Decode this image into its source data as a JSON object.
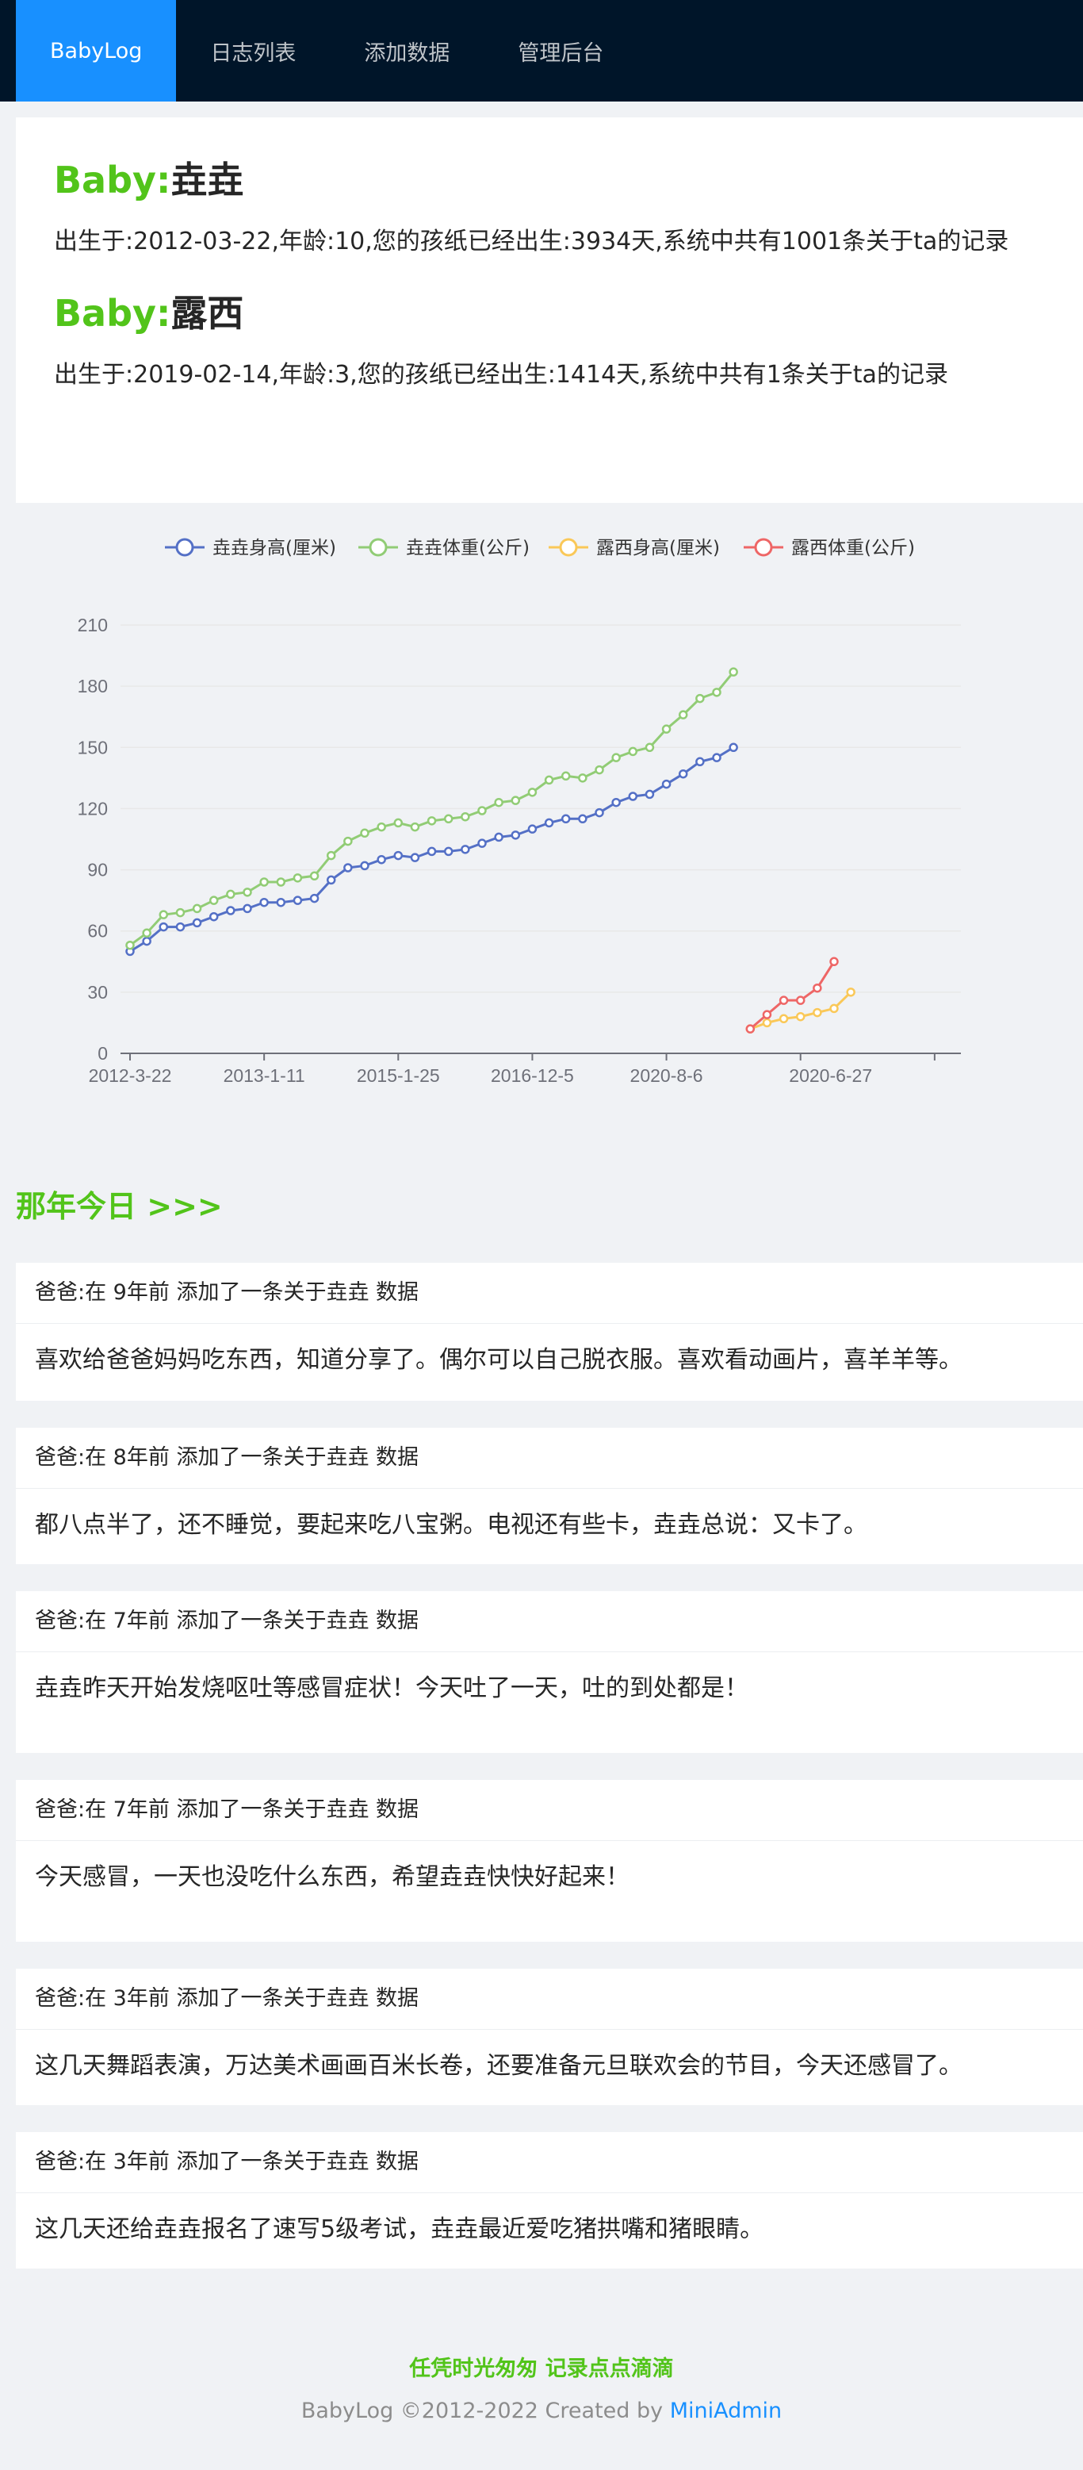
{
  "nav": {
    "items": [
      {
        "label": "BabyLog",
        "active": true
      },
      {
        "label": "日志列表",
        "active": false
      },
      {
        "label": "添加数据",
        "active": false
      },
      {
        "label": "管理后台",
        "active": false
      }
    ]
  },
  "babies": [
    {
      "prefix": "Baby:",
      "name": "垚垚",
      "desc": "出生于:2012-03-22,年龄:10,您的孩纸已经出生:3934天,系统中共有1001条关于ta的记录"
    },
    {
      "prefix": "Baby:",
      "name": "露西",
      "desc": "出生于:2019-02-14,年龄:3,您的孩纸已经出生:1414天,系统中共有1条关于ta的记录"
    }
  ],
  "chart_data": {
    "type": "line",
    "legend_position": "top-center",
    "grid": true,
    "ylim": [
      0,
      210
    ],
    "yticks": [
      0,
      30,
      60,
      90,
      120,
      150,
      180,
      210
    ],
    "xtick_labels": [
      "2012-3-22",
      "2013-1-11",
      "2015-1-25",
      "2016-12-5",
      "2020-8-6",
      "2020-6-27"
    ],
    "series": [
      {
        "name": "垚垚身高(厘米)",
        "color": "#5470c6",
        "values": [
          50,
          55,
          62,
          62,
          64,
          67,
          70,
          71,
          74,
          74,
          75,
          76,
          85,
          91,
          92,
          95,
          97,
          96,
          99,
          99,
          100,
          103,
          106,
          107,
          110,
          113,
          115,
          115,
          118,
          123,
          126,
          127,
          132,
          137,
          143,
          145,
          150
        ]
      },
      {
        "name": "垚垚体重(公斤)",
        "color": "#91cc75",
        "values": [
          53,
          59,
          68,
          69,
          71,
          75,
          78,
          79,
          84,
          84,
          86,
          87,
          97,
          104,
          108,
          111,
          113,
          111,
          114,
          115,
          116,
          119,
          123,
          124,
          128,
          134,
          136,
          135,
          139,
          145,
          148,
          150,
          159,
          166,
          174,
          177,
          187
        ]
      },
      {
        "name": "露西身高(厘米)",
        "color": "#fac858",
        "values": [
          12,
          15,
          17,
          18,
          20,
          22,
          30
        ]
      },
      {
        "name": "露西体重(公斤)",
        "color": "#ee6666",
        "values": [
          12,
          19,
          26,
          26,
          32,
          45
        ]
      }
    ]
  },
  "today": {
    "title": "那年今日 >>>",
    "entries": [
      {
        "head": "爸爸:在 9年前 添加了一条关于垚垚 数据",
        "body": "喜欢给爸爸妈妈吃东西，知道分享了。偶尔可以自己脱衣服。喜欢看动画片，喜羊羊等。"
      },
      {
        "head": "爸爸:在 8年前 添加了一条关于垚垚 数据",
        "body": "都八点半了，还不睡觉，要起来吃八宝粥。电视还有些卡，垚垚总说：又卡了。"
      },
      {
        "head": "爸爸:在 7年前 添加了一条关于垚垚 数据",
        "body": "垚垚昨天开始发烧呕吐等感冒症状！今天吐了一天，吐的到处都是！"
      },
      {
        "head": "爸爸:在 7年前 添加了一条关于垚垚 数据",
        "body": "今天感冒，一天也没吃什么东西，希望垚垚快快好起来！"
      },
      {
        "head": "爸爸:在 3年前 添加了一条关于垚垚 数据",
        "body": "这几天舞蹈表演，万达美术画画百米长卷，还要准备元旦联欢会的节目，今天还感冒了。"
      },
      {
        "head": "爸爸:在 3年前 添加了一条关于垚垚 数据",
        "body": "这几天还给垚垚报名了速写5级考试，垚垚最近爱吃猪拱嘴和猪眼睛。"
      }
    ]
  },
  "footer": {
    "slogan": "任凭时光匆匆 记录点点滴滴",
    "copyright": "BabyLog ©2012-2022 Created by ",
    "link": "MiniAdmin"
  }
}
